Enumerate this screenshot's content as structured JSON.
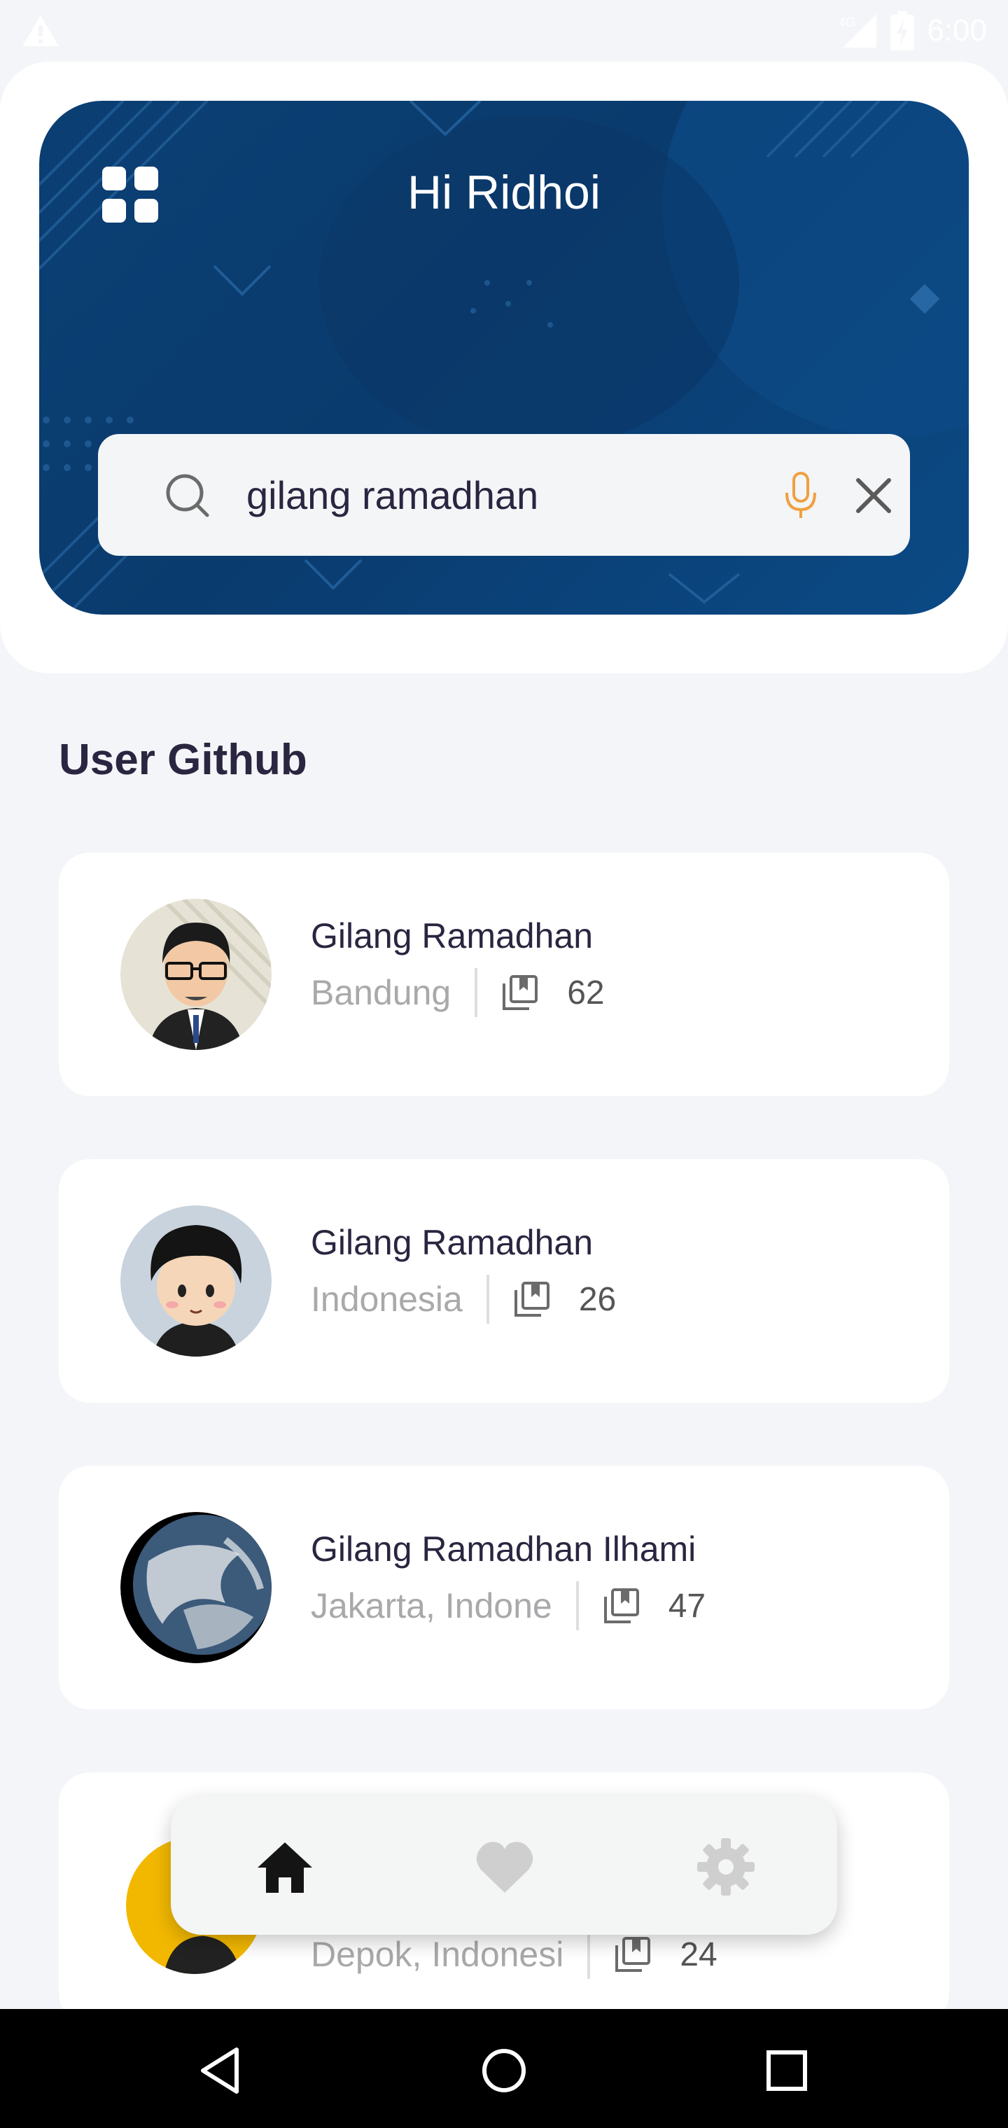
{
  "status_bar": {
    "time": "6:00",
    "network": "4G"
  },
  "header": {
    "greeting": "Hi Ridhoi",
    "menu_icon": "grid-icon"
  },
  "search": {
    "value": "gilang ramadhan",
    "search_icon": "search-icon",
    "mic_icon": "mic-icon",
    "clear_icon": "close-icon"
  },
  "section": {
    "title": "User Github"
  },
  "users": [
    {
      "name": "Gilang Ramadhan",
      "location": "Bandung",
      "repos": "62",
      "avatar": "avatar-glasses-man"
    },
    {
      "name": "Gilang Ramadhan",
      "location": "Indonesia",
      "repos": "26",
      "avatar": "avatar-cartoon-boy"
    },
    {
      "name": "Gilang Ramadhan Ilhami",
      "location": "Jakarta, Indone",
      "repos": "47",
      "avatar": "avatar-earth"
    },
    {
      "name": "",
      "location": "Depok, Indonesi",
      "repos": "24",
      "avatar": "avatar-yellow"
    }
  ],
  "bottom_nav": {
    "items": [
      "home-icon",
      "heart-icon",
      "settings-icon"
    ],
    "active": "home-icon"
  },
  "colors": {
    "hero": "#0b3f73",
    "accent_mic": "#f0a040",
    "text_primary": "#2a2540",
    "text_muted": "#a9a9ab"
  }
}
